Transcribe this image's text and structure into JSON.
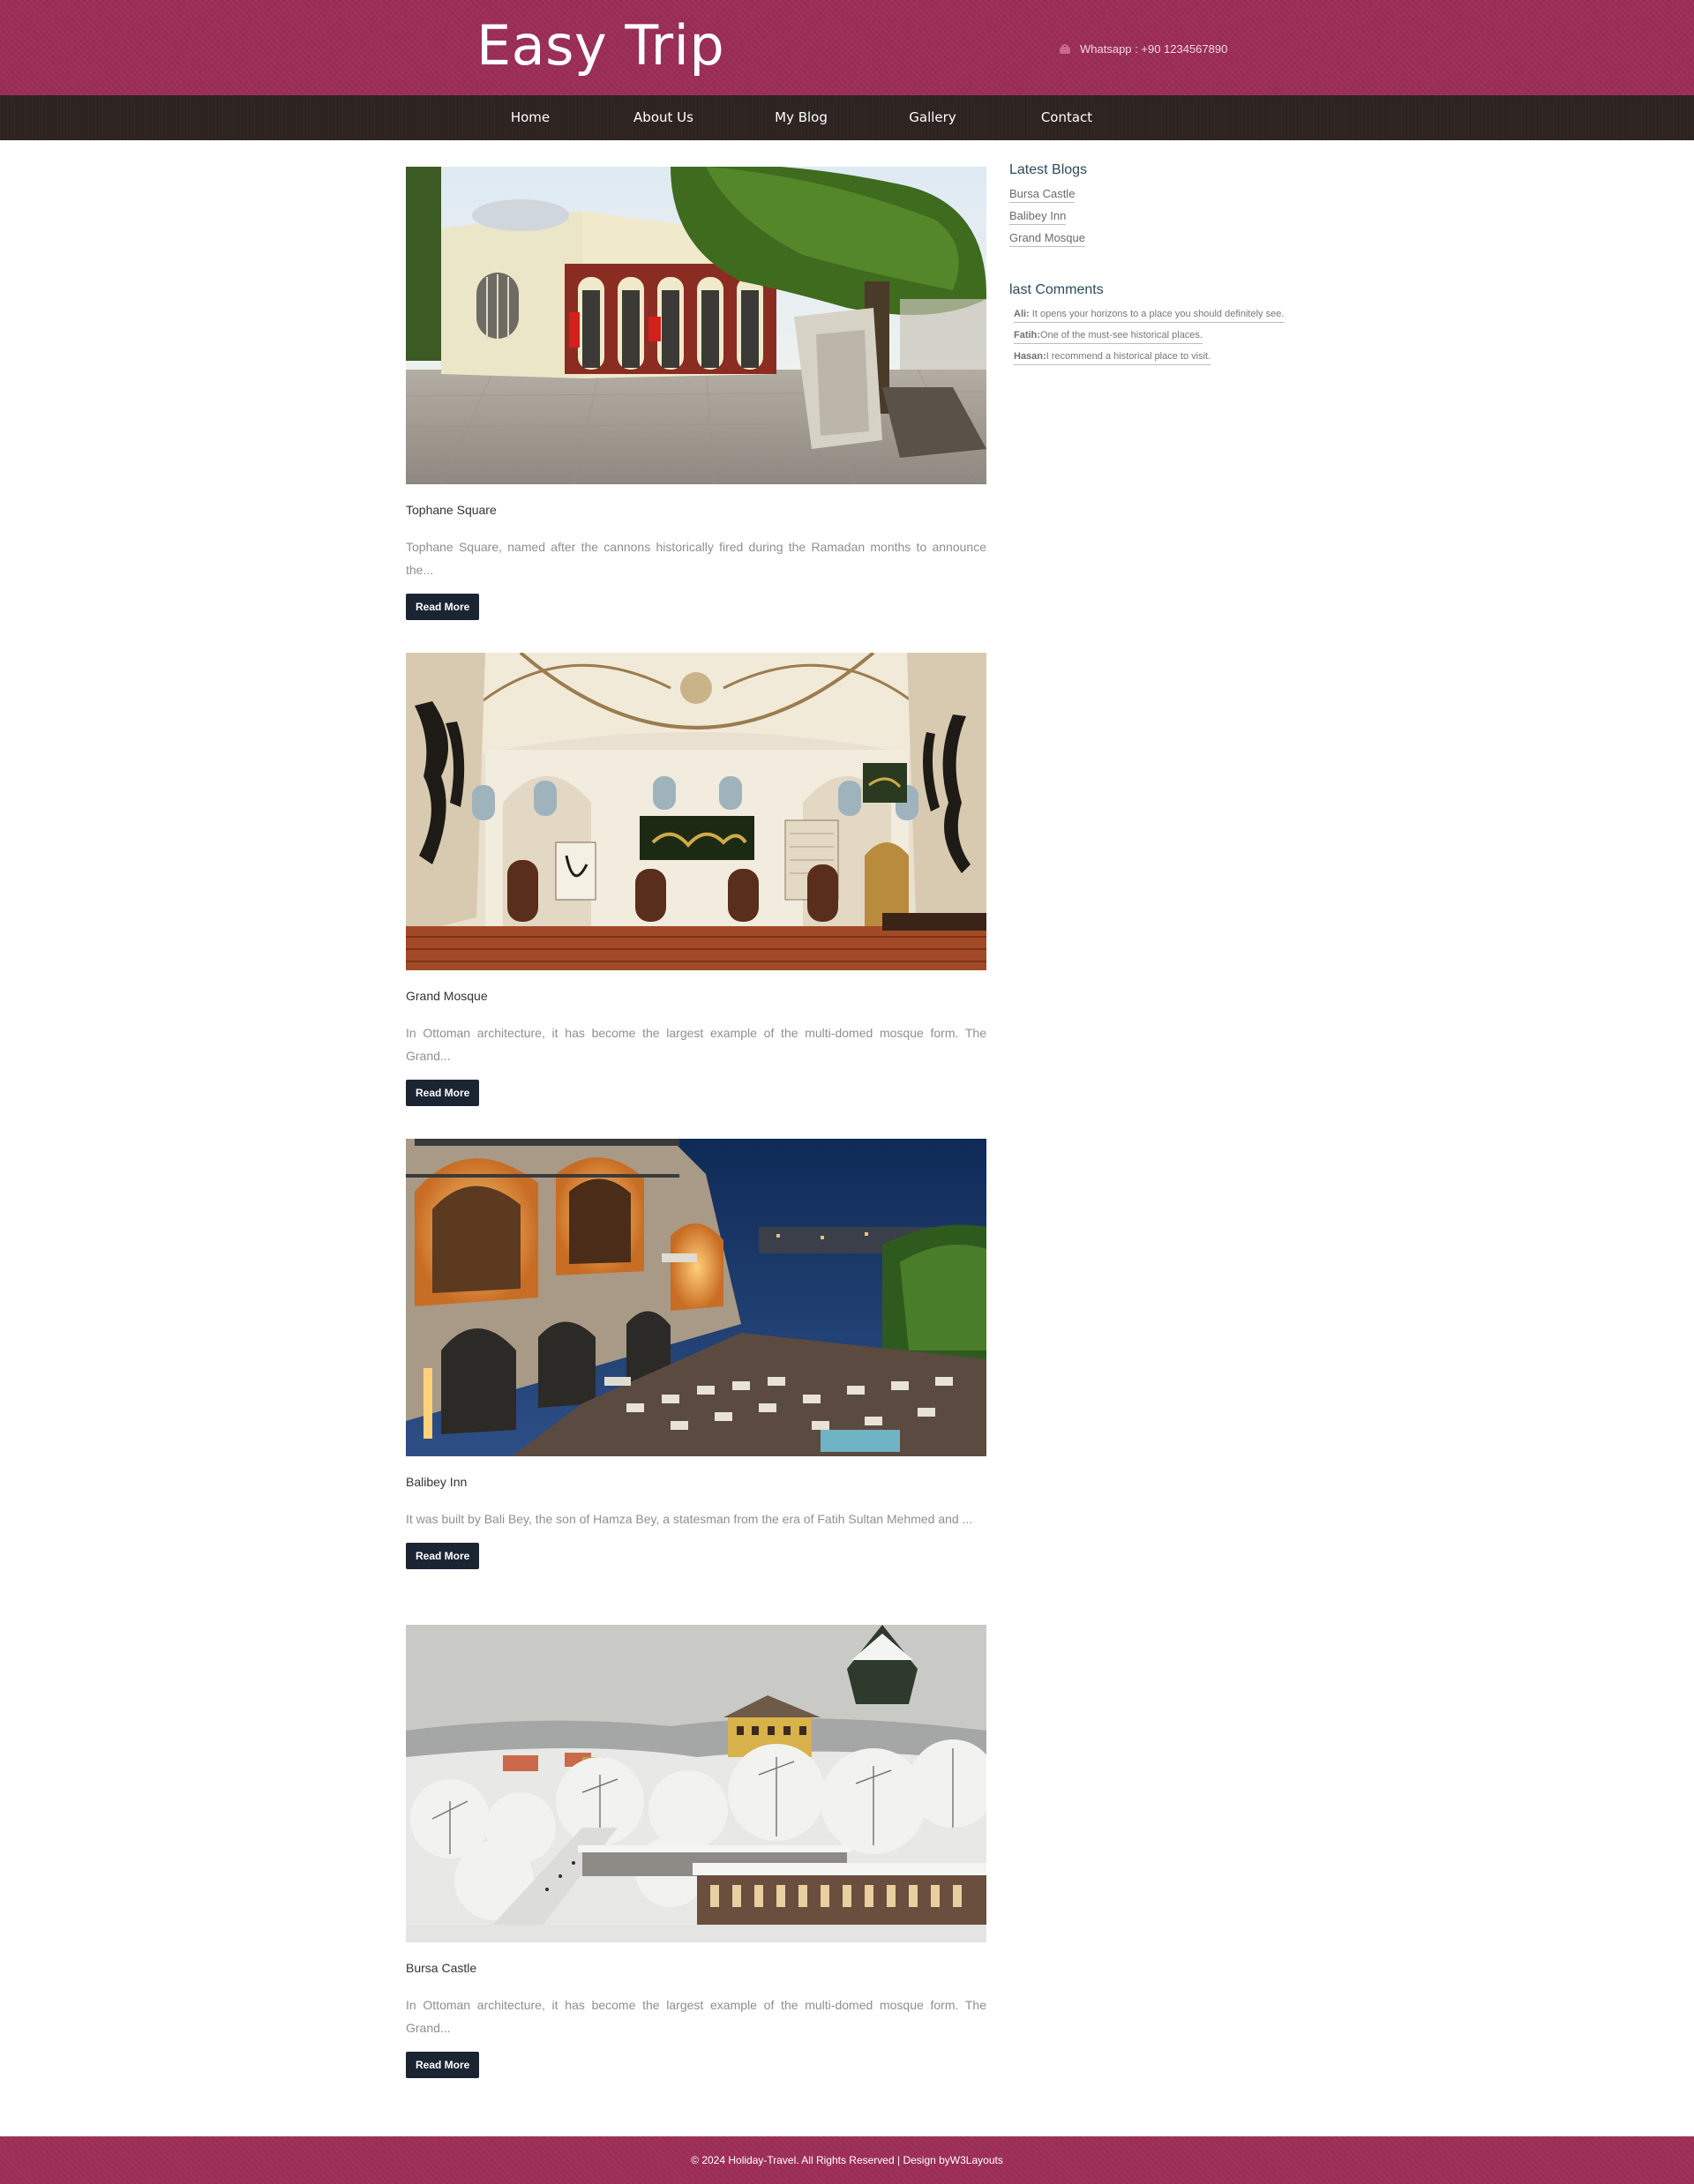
{
  "header": {
    "logo": "Easy Trip",
    "whatsapp": "Whatsapp : +90 1234567890",
    "phone_icon": "phone-icon"
  },
  "nav": {
    "items": [
      {
        "label": "Home"
      },
      {
        "label": "About Us"
      },
      {
        "label": "My Blog"
      },
      {
        "label": "Gallery"
      },
      {
        "label": "Contact"
      }
    ]
  },
  "posts": [
    {
      "title": "Tophane Square",
      "excerpt": "Tophane Square, named after the cannons historically fired during the Ramadan months to announce the...",
      "read_more": "Read More"
    },
    {
      "title": "Grand Mosque",
      "excerpt": "In Ottoman architecture, it has become the largest example of the multi-domed mosque form. The Grand...",
      "read_more": "Read More"
    },
    {
      "title": "Balibey Inn",
      "excerpt": "It was built by Bali Bey, the son of Hamza Bey, a statesman from the era of Fatih Sultan Mehmed and ...",
      "read_more": "Read More"
    },
    {
      "title": "Bursa Castle",
      "excerpt": "In Ottoman architecture, it has become the largest example of the multi-domed mosque form. The Grand...",
      "read_more": "Read More"
    }
  ],
  "sidebar": {
    "latest_heading": "Latest Blogs",
    "latest": [
      "Bursa Castle",
      "Balibey Inn",
      "Grand Mosque"
    ],
    "comments_heading": "last Comments",
    "comments": [
      {
        "author": "Ali:",
        "text": "It opens your horizons to a place you should definitely see."
      },
      {
        "author": "Fatih:",
        "text": "One of the must-see historical places."
      },
      {
        "author": "Hasan:",
        "text": "I recommend a historical place to visit."
      }
    ]
  },
  "footer": {
    "text": "© 2024 Holiday-Travel. All Rights Reserved | Design byW3Layouts"
  },
  "colors": {
    "header_bg": "#9c2d55",
    "nav_bg": "#2d2422",
    "button_bg": "#1b2433"
  }
}
